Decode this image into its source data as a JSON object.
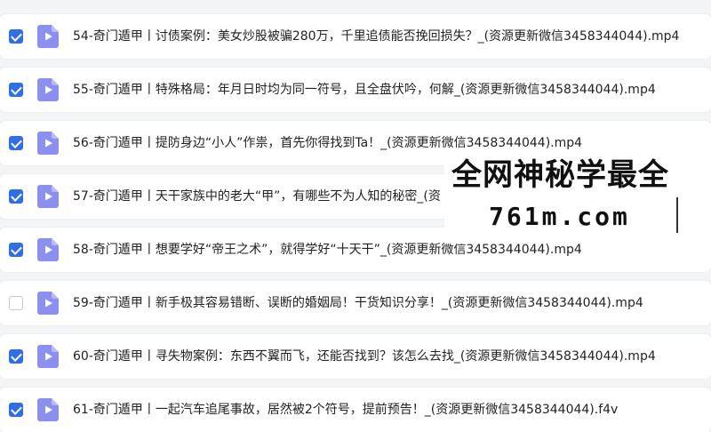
{
  "colors": {
    "accent": "#2f6ee6",
    "file_icon": "#8b8ff0"
  },
  "files": [
    {
      "name": "54-奇门遁甲丨讨债案例：美女炒股被骗280万，千里追债能否挽回损失？_(资源更新微信3458344044).mp4",
      "checked": true,
      "icon": "video-file-icon"
    },
    {
      "name": "55-奇门遁甲丨特殊格局：年月日时均为同一符号，且全盘伏吟，何解_(资源更新微信3458344044).mp4",
      "checked": true,
      "icon": "video-file-icon"
    },
    {
      "name": "56-奇门遁甲丨提防身边“小人”作祟，首先你得找到Ta！_(资源更新微信3458344044).mp4",
      "checked": true,
      "icon": "video-file-icon"
    },
    {
      "name": "57-奇门遁甲丨天干家族中的老大“甲”，有哪些不为人知的秘密_(资",
      "checked": true,
      "icon": "video-file-icon"
    },
    {
      "name": "58-奇门遁甲丨想要学好“帝王之术”，就得学好“十天干”_(资源更新微信3458344044).mp4",
      "checked": true,
      "icon": "video-file-icon"
    },
    {
      "name": "59-奇门遁甲丨新手极其容易错断、误断的婚姻局！干货知识分享！_(资源更新微信3458344044).mp4",
      "checked": false,
      "icon": "video-file-icon"
    },
    {
      "name": "60-奇门遁甲丨寻失物案例：东西不翼而飞，还能否找到？该怎么去找_(资源更新微信3458344044).mp4",
      "checked": true,
      "icon": "video-file-icon"
    },
    {
      "name": "61-奇门遁甲丨一起汽车追尾事故，居然被2个符号，提前预告！_(资源更新微信3458344044).f4v",
      "checked": true,
      "icon": "video-file-icon"
    }
  ],
  "watermark": {
    "title": "全网神秘学最全",
    "site": "761m.com"
  }
}
